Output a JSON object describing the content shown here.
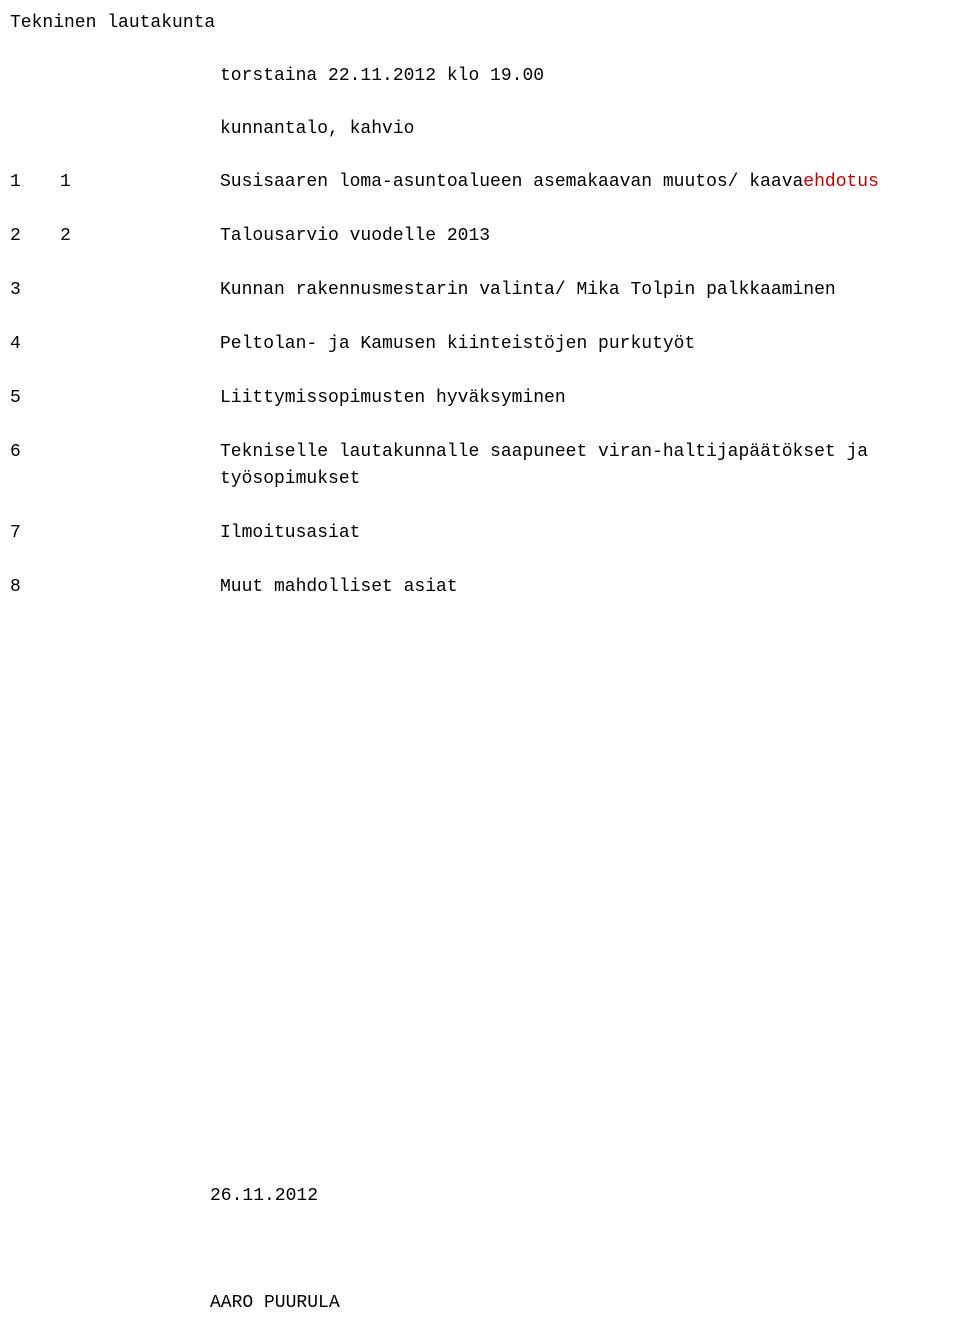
{
  "header": {
    "title": "Tekninen lautakunta",
    "datetime": "torstaina 22.11.2012 klo 19.00",
    "location": "kunnantalo, kahvio"
  },
  "agenda": [
    {
      "num": "1",
      "sub": "1",
      "text_pre": "Susisaaren loma-asuntoalueen asemakaavan muutos/ kaava",
      "text_red": "ehdotus",
      "text_post": ""
    },
    {
      "num": "2",
      "sub": "2",
      "text_pre": "Talousarvio vuodelle 2013",
      "text_red": "",
      "text_post": ""
    },
    {
      "num": "3",
      "sub": "",
      "text_pre": "Kunnan rakennusmestarin valinta/ Mika Tolpin palkkaaminen",
      "text_red": "",
      "text_post": ""
    },
    {
      "num": "4",
      "sub": "",
      "text_pre": "Peltolan- ja Kamusen kiinteistöjen purkutyöt",
      "text_red": "",
      "text_post": ""
    },
    {
      "num": "5",
      "sub": "",
      "text_pre": "Liittymissopimusten hyväksyminen",
      "text_red": "",
      "text_post": ""
    },
    {
      "num": "6",
      "sub": "",
      "text_pre": "Tekniselle lautakunnalle saapuneet viran-haltijapäätökset ja työsopimukset",
      "text_red": "",
      "text_post": ""
    },
    {
      "num": "7",
      "sub": "",
      "text_pre": "Ilmoitusasiat",
      "text_red": "",
      "text_post": ""
    },
    {
      "num": "8",
      "sub": "",
      "text_pre": "Muut mahdolliset asiat",
      "text_red": "",
      "text_post": ""
    }
  ],
  "footer": {
    "date": "26.11.2012",
    "signature": "AARO PUURULA"
  }
}
